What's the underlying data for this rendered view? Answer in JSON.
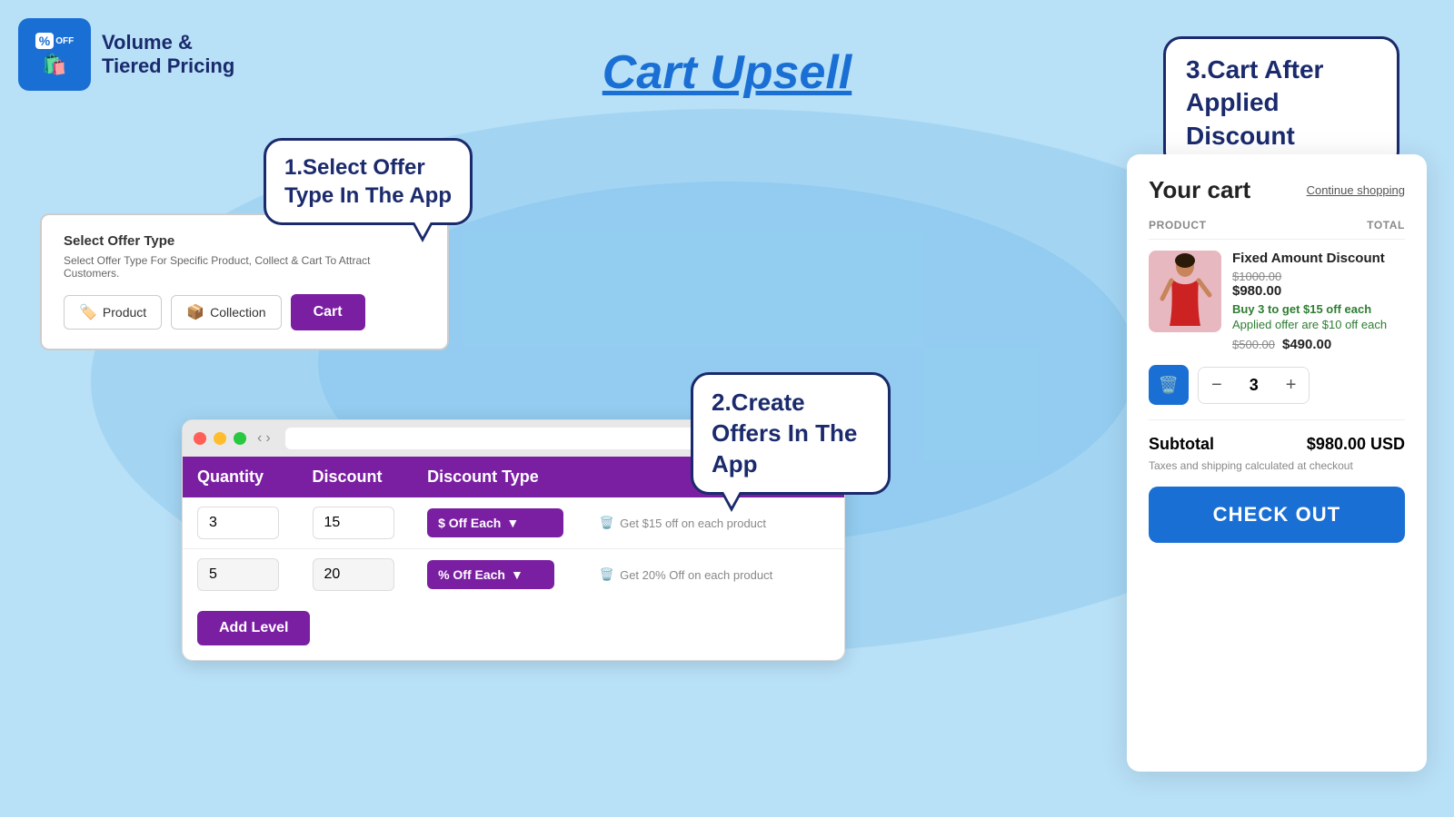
{
  "app": {
    "logo_text_line1": "Volume &",
    "logo_text_line2": "Tiered Pricing",
    "main_title": "Cart Upsell"
  },
  "bubble_top_right": {
    "text": "3.Cart After Applied Discount"
  },
  "bubble_1": {
    "text": "1.Select Offer Type In The App"
  },
  "bubble_2": {
    "text": "2.Create Offers In The App"
  },
  "offer_panel": {
    "title": "Select Offer Type",
    "description": "Select Offer Type For Specific Product, Collect & Cart To Attract Customers.",
    "btn_product": "Product",
    "btn_collection": "Collection",
    "btn_cart": "Cart"
  },
  "pricing_table": {
    "col_quantity": "Quantity",
    "col_discount": "Discount",
    "col_discount_type": "Discount Type",
    "row1": {
      "qty": "3",
      "discount": "15",
      "type": "$ Off Each",
      "hint": "Get $15 off on each product"
    },
    "row2": {
      "qty": "5",
      "discount": "20",
      "type": "% Off Each",
      "hint": "Get 20% Off on each product"
    },
    "add_level": "Add Level"
  },
  "cart": {
    "title": "Your cart",
    "continue_shopping": "Continue shopping",
    "col_product": "PRODUCT",
    "col_total": "TOTAL",
    "item": {
      "name": "Fixed Amount Discount",
      "price_original": "$1000.00",
      "price_discounted": "$980.00",
      "offer_text": "Buy 3 to get $15 off each",
      "applied_text": "Applied offer are $10 off each",
      "price_strike": "$500.00",
      "price_final": "$490.00"
    },
    "qty": "3",
    "subtotal_label": "Subtotal",
    "subtotal_value": "$980.00 USD",
    "tax_note": "Taxes and shipping calculated at checkout",
    "checkout_btn": "CHECK OUT"
  }
}
